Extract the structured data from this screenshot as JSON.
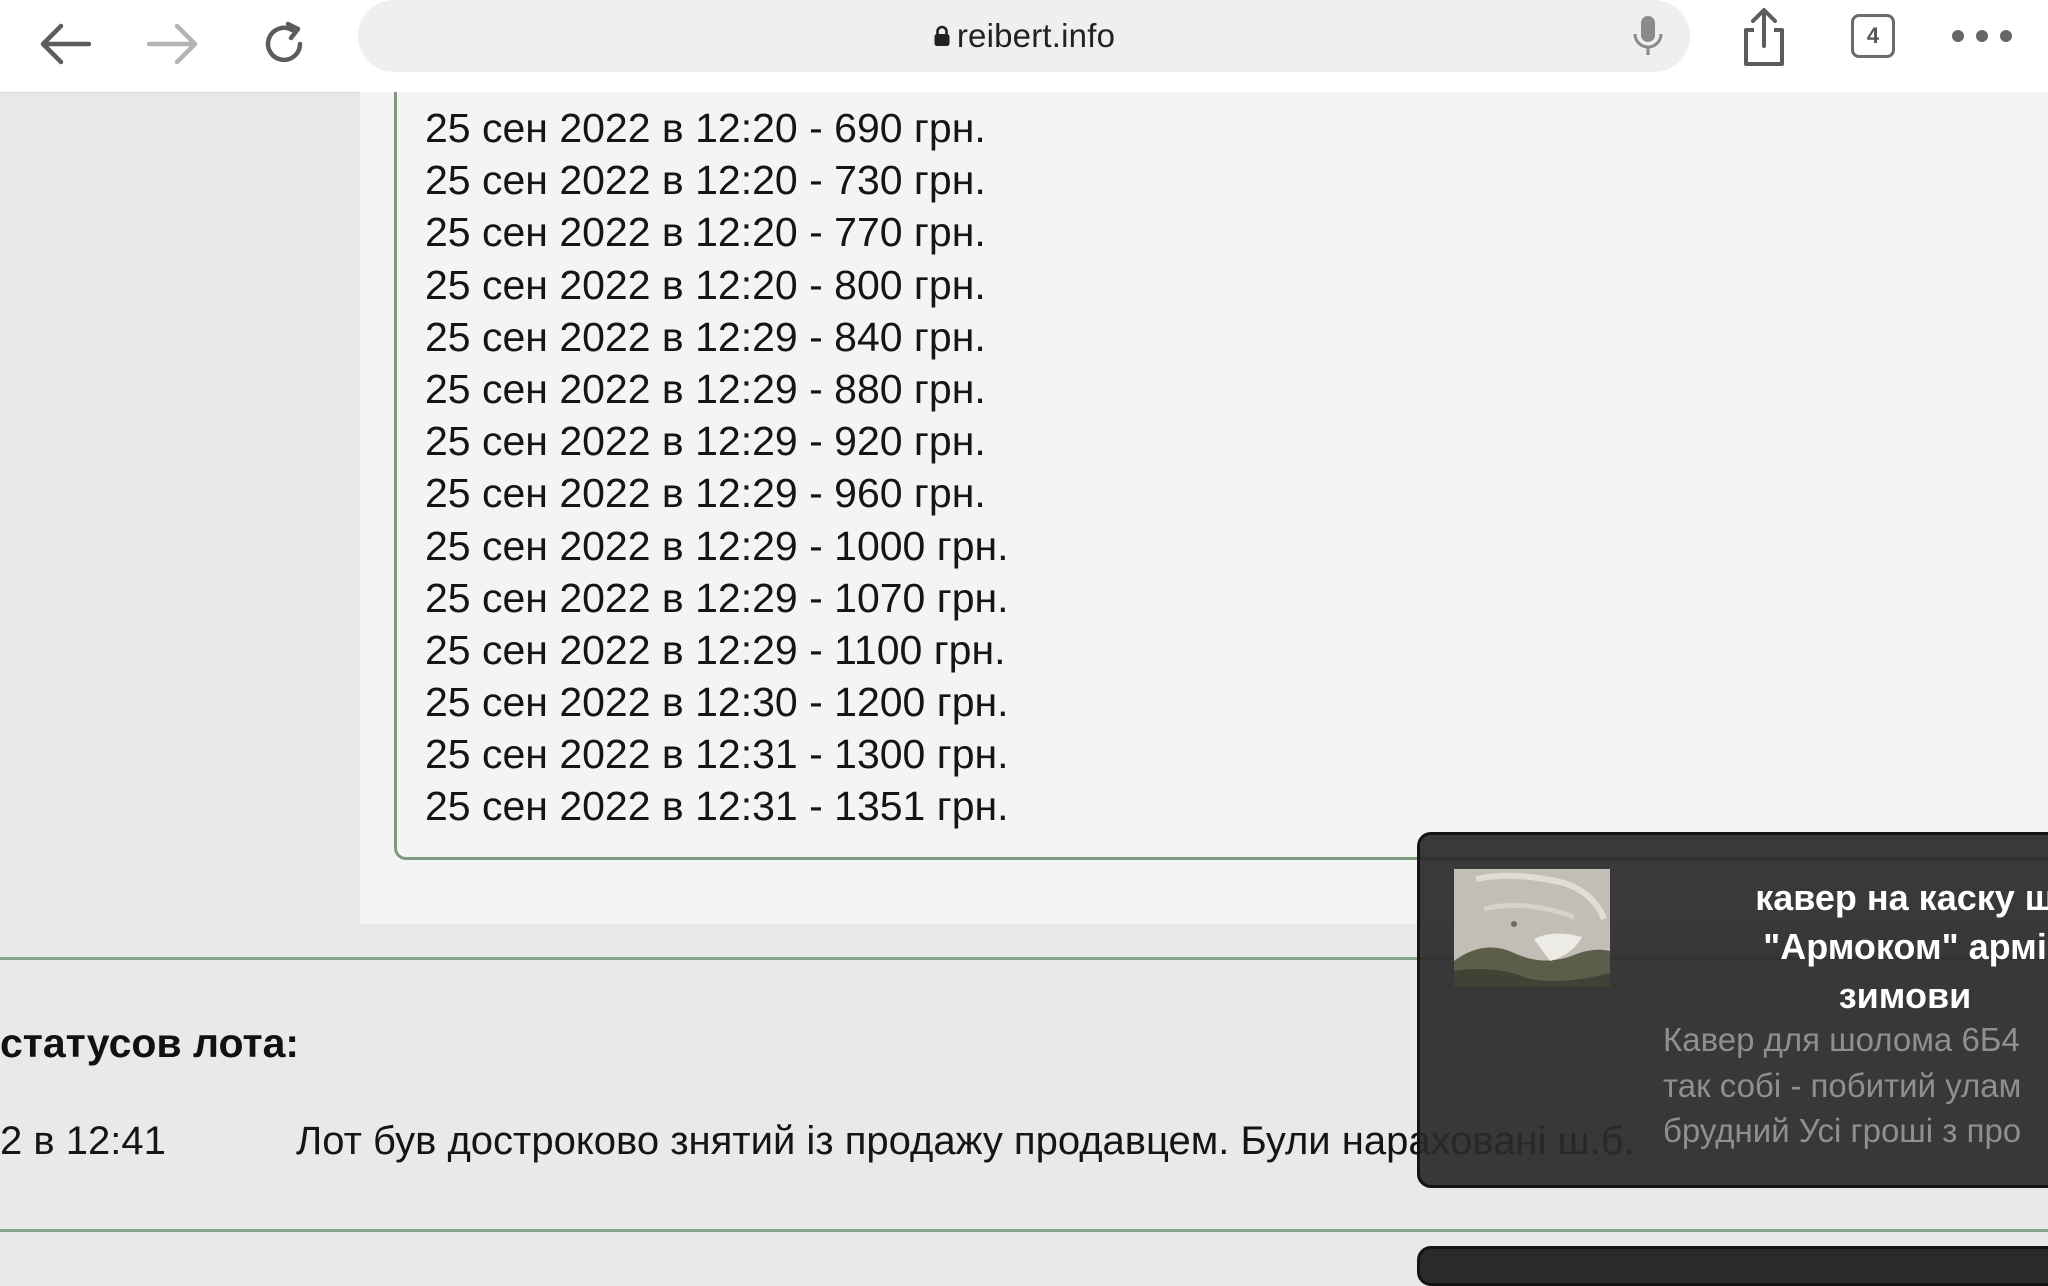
{
  "browser": {
    "url": "reibert.info",
    "tab_count": "4",
    "icons": [
      "back-arrow-icon",
      "forward-arrow-icon",
      "reload-icon",
      "lock-icon",
      "microphone-icon",
      "share-icon",
      "tabs-icon",
      "more-icon"
    ]
  },
  "bids": [
    "25 сен 2022 в 12:20 - 690 грн.",
    "25 сен 2022 в 12:20 - 730 грн.",
    "25 сен 2022 в 12:20 - 770 грн.",
    "25 сен 2022 в 12:20 - 800 грн.",
    "25 сен 2022 в 12:29 - 840 грн.",
    "25 сен 2022 в 12:29 - 880 грн.",
    "25 сен 2022 в 12:29 - 920 грн.",
    "25 сен 2022 в 12:29 - 960 грн.",
    "25 сен 2022 в 12:29 - 1000 грн.",
    "25 сен 2022 в 12:29 - 1070 грн.",
    "25 сен 2022 в 12:29 - 1100 грн.",
    "25 сен 2022 в 12:30 - 1200 грн.",
    "25 сен 2022 в 12:31 - 1300 грн.",
    "25 сен 2022 в 12:31 - 1351 грн."
  ],
  "status": {
    "heading": "статусов лота:",
    "time": "2 в 12:41",
    "text": "Лот був достроково знятий із продажу продавцем. Були нараховані ш.б."
  },
  "popup": {
    "title_lines": [
      "кавер на каску ш",
      "\"Армоком\" армі",
      "зимови"
    ],
    "description_lines": [
      "Кавер для шолома 6Б4",
      "так собі - побитий улам",
      "брудний Усі гроші з про"
    ]
  },
  "colors": {
    "accent_border": "#7d9a7d",
    "popup_bg": "#2a2a2a"
  }
}
